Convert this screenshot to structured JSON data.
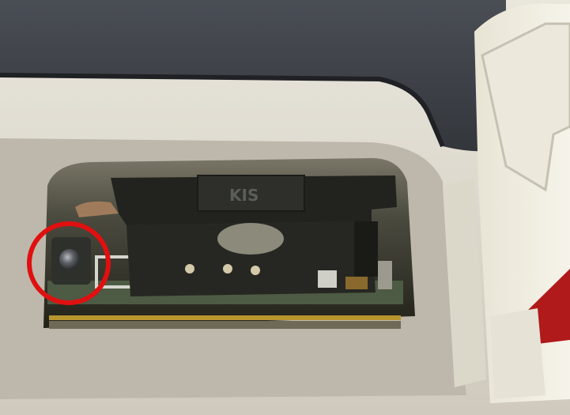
{
  "photo": {
    "component_marking": "KIS",
    "highlight_color": "#e01010",
    "colors": {
      "lid_dark": "#3b3f45",
      "housing_plastic": "#d8d4c8",
      "cavity": "#2a2b25",
      "gold_strip": "#b8952e",
      "hinge_red": "#b01a1a"
    }
  }
}
